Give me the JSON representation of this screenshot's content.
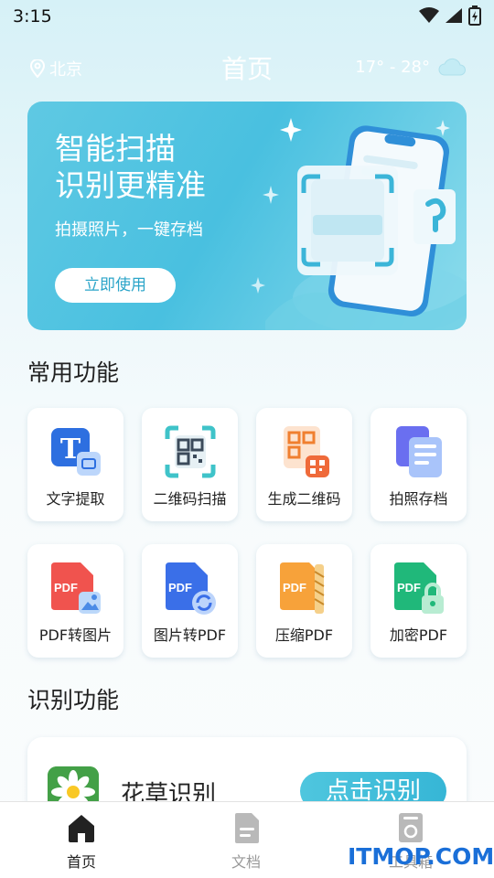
{
  "status_bar": {
    "time": "3:15"
  },
  "header": {
    "location": "北京",
    "title": "首页",
    "weather": "17° - 28°"
  },
  "banner": {
    "title_line1": "智能扫描",
    "title_line2": "识别更精准",
    "subtitle": "拍摄照片，一键存档",
    "button": "立即使用"
  },
  "common": {
    "title": "常用功能",
    "items": [
      {
        "label": "文字提取",
        "icon": "text-extract-icon"
      },
      {
        "label": "二维码扫描",
        "icon": "qr-scan-icon"
      },
      {
        "label": "生成二维码",
        "icon": "qr-generate-icon"
      },
      {
        "label": "拍照存档",
        "icon": "photo-archive-icon"
      },
      {
        "label": "PDF转图片",
        "icon": "pdf-to-image-icon"
      },
      {
        "label": "图片转PDF",
        "icon": "image-to-pdf-icon"
      },
      {
        "label": "压缩PDF",
        "icon": "compress-pdf-icon"
      },
      {
        "label": "加密PDF",
        "icon": "encrypt-pdf-icon"
      }
    ]
  },
  "recognition": {
    "title": "识别功能",
    "item_name": "花草识别",
    "item_button": "点击识别"
  },
  "nav": {
    "home": "首页",
    "docs": "文档",
    "third": "工具箱"
  },
  "watermark": "ITMOP.COM",
  "colors": {
    "accent": "#36b6d6",
    "banner": "#49c0e0",
    "watermark": "#1a6fd8"
  }
}
